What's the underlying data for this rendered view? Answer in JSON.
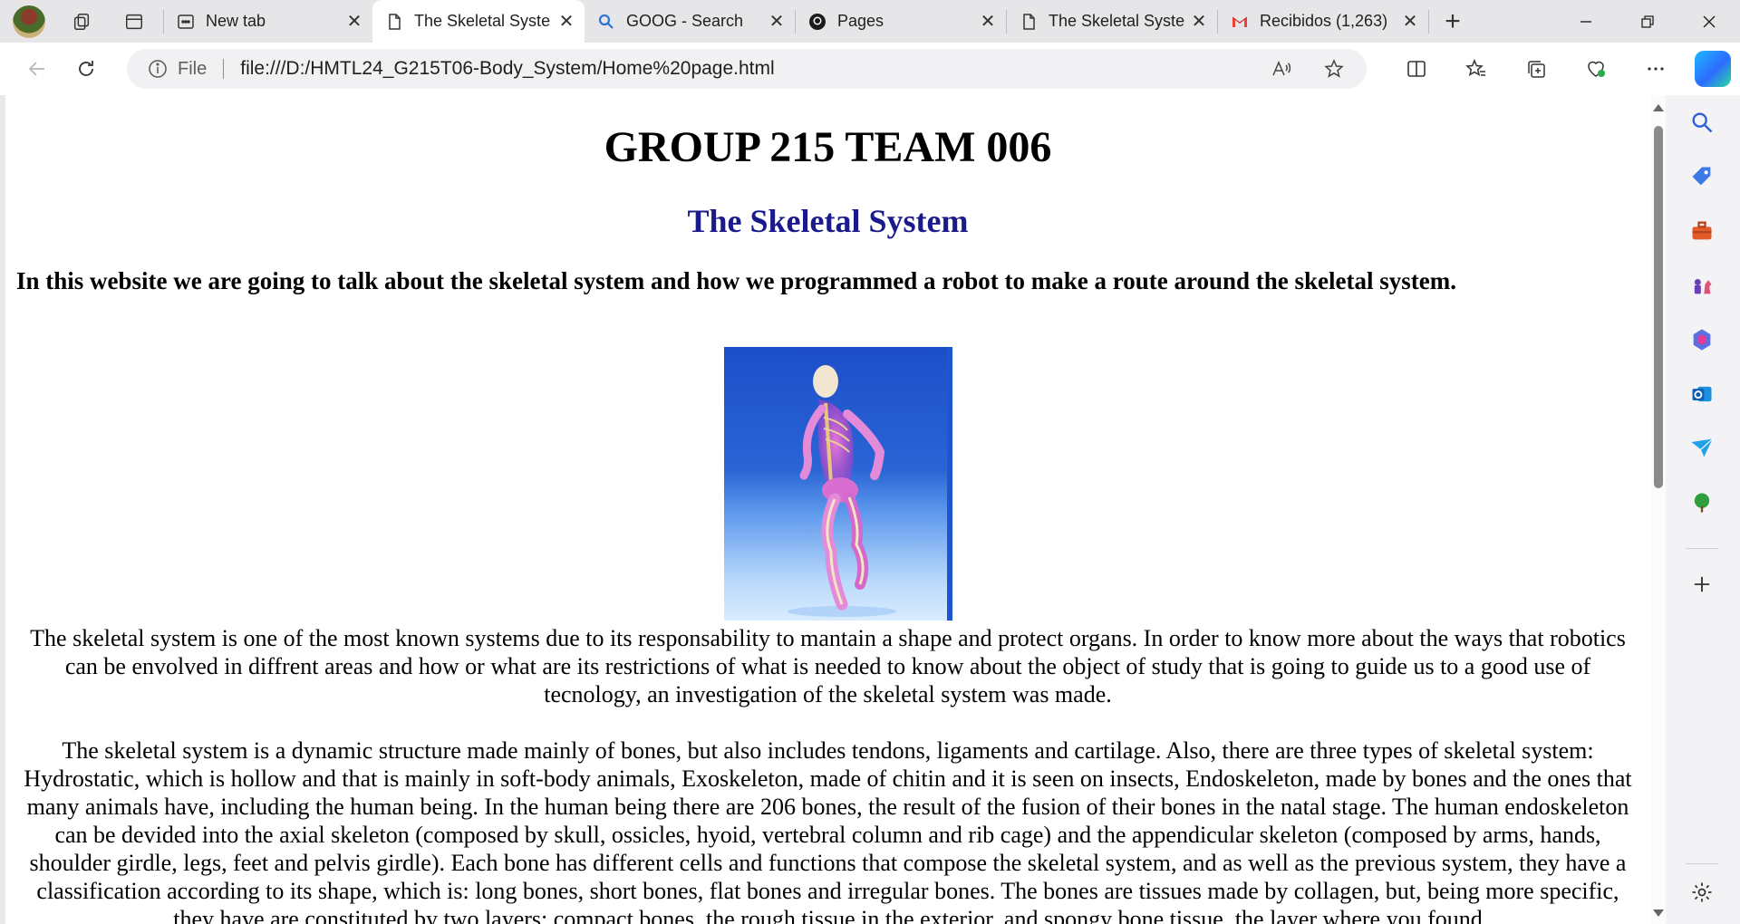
{
  "browser": {
    "tabs": [
      {
        "title": "New tab",
        "icon": "newtab-icon",
        "active": false
      },
      {
        "title": "The Skeletal Syste",
        "icon": "document-icon",
        "active": true
      },
      {
        "title": "GOOG - Search",
        "icon": "search-icon",
        "active": false
      },
      {
        "title": "Pages",
        "icon": "github-icon",
        "active": false
      },
      {
        "title": "The Skeletal Syste",
        "icon": "document-icon",
        "active": false
      },
      {
        "title": "Recibidos (1,263)",
        "icon": "gmail-icon",
        "active": false
      }
    ],
    "close_glyph": "✕",
    "new_tab_glyph": "+",
    "address": {
      "scheme_label": "File",
      "url": "file:///D:/HMTL24_G215T06-Body_System/Home%20page.html"
    },
    "colors": {
      "tab_bar": "#e6e6e9",
      "toolbar": "#ffffff",
      "sidebar": "#f3f3f6"
    }
  },
  "page": {
    "heading": "GROUP 215 TEAM 006",
    "subheading": "The Skeletal System",
    "intro": "In this website we are going to talk about the skeletal system and how we programmed a robot to make a route around the skeletal system.",
    "hero_image": "running-skeleton-image",
    "paragraphs": [
      "The skeletal system is one of the most known systems due to its responsability to mantain a shape and protect organs. In order to know more about the ways that robotics can be envolved in diffrent areas and how or what are its restrictions of what is needed to know about the object of study that is going to guide us to a good use of tecnology, an investigation of the skeletal system was made.",
      "The skeletal system is a dynamic structure made mainly of bones, but also includes tendons, ligaments and cartilage. Also, there are three types of skeletal system: Hydrostatic, which is hollow and that is mainly in soft-body animals, Exoskeleton, made of chitin and it is seen on insects, Endoskeleton, made by bones and the ones that many animals have, including the human being. In the human being there are 206 bones, the result of the fusion of their bones in the natal stage. The human endoskeleton can be devided into the axial skeleton (composed by skull, ossicles, hyoid, vertebral column and rib cage) and the appendicular skeleton (composed by arms, hands, shoulder girdle, legs, feet and pelvis girdle). Each bone has different cells and functions that compose the skeletal system, and as well as the previous system, they have a classification according to its shape, which is: long bones, short bones, flat bones and irregular bones. The bones are tissues made by collagen, but, being more specific, they have are constituted by two layers: compact bones, the rough tissue in the exterior, and spongy bone tissue, the layer where you found"
    ],
    "colors": {
      "subheading": "#1a1a8c",
      "text": "#000000"
    }
  }
}
